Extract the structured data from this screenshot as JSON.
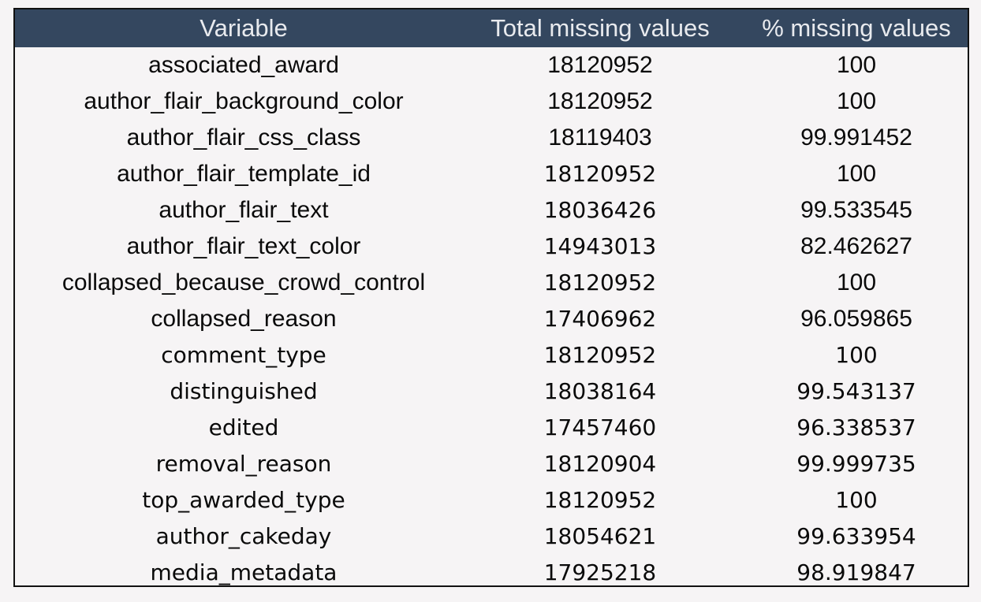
{
  "table": {
    "columns": [
      "Variable",
      "Total missing values",
      "% missing values"
    ],
    "header_color": "#34475f",
    "rows": [
      {
        "variable": "associated_award",
        "total_missing": "18120952",
        "pct_missing": "100"
      },
      {
        "variable": "author_flair_background_color",
        "total_missing": "18120952",
        "pct_missing": "100"
      },
      {
        "variable": "author_flair_css_class",
        "total_missing": "18119403",
        "pct_missing": "99.991452"
      },
      {
        "variable": "author_flair_template_id",
        "total_missing": "18120952",
        "pct_missing": "100"
      },
      {
        "variable": "author_flair_text",
        "total_missing": "18036426",
        "pct_missing": "99.533545"
      },
      {
        "variable": "author_flair_text_color",
        "total_missing": "14943013",
        "pct_missing": "82.462627"
      },
      {
        "variable": "collapsed_because_crowd_control",
        "total_missing": "18120952",
        "pct_missing": "100"
      },
      {
        "variable": "collapsed_reason",
        "total_missing": "17406962",
        "pct_missing": "96.059865"
      },
      {
        "variable": "comment_type",
        "total_missing": "18120952",
        "pct_missing": "100"
      },
      {
        "variable": "distinguished",
        "total_missing": "18038164",
        "pct_missing": "99.543137"
      },
      {
        "variable": "edited",
        "total_missing": "17457460",
        "pct_missing": "96.338537"
      },
      {
        "variable": "removal_reason",
        "total_missing": "18120904",
        "pct_missing": "99.999735"
      },
      {
        "variable": "top_awarded_type",
        "total_missing": "18120952",
        "pct_missing": "100"
      },
      {
        "variable": "author_cakeday",
        "total_missing": "18054621",
        "pct_missing": "99.633954"
      },
      {
        "variable": "media_metadata",
        "total_missing": "17925218",
        "pct_missing": "98.919847"
      }
    ]
  }
}
